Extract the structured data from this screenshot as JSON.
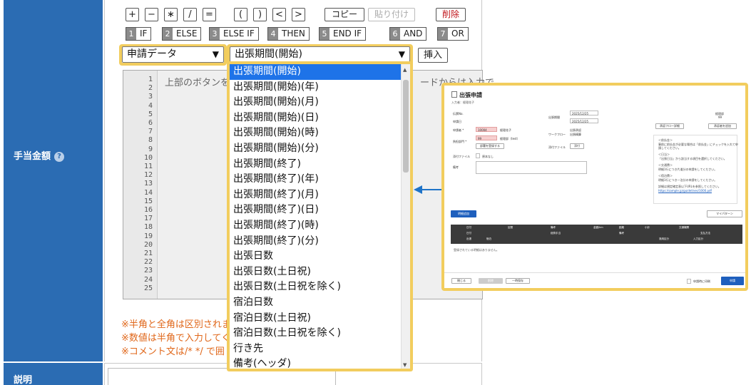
{
  "labels": {
    "amount": "手当金額",
    "amount_help": "?",
    "description": "説明"
  },
  "operators": [
    "+",
    "−",
    "∗",
    "/",
    "=",
    "(",
    ")",
    "<",
    ">"
  ],
  "actions": {
    "copy": "コピー",
    "paste": "貼り付け",
    "delete": "削除",
    "insert": "挿入"
  },
  "keywords": [
    {
      "num": "1",
      "label": "IF"
    },
    {
      "num": "2",
      "label": "ELSE"
    },
    {
      "num": "3",
      "label": "ELSE IF"
    },
    {
      "num": "4",
      "label": "THEN"
    },
    {
      "num": "5",
      "label": "END IF"
    },
    {
      "num": "6",
      "label": "AND"
    },
    {
      "num": "7",
      "label": "OR"
    }
  ],
  "source_select": {
    "value": "申請データ"
  },
  "field_select": {
    "value": "出張期間(開始)"
  },
  "code": {
    "line_numbers": [
      "1",
      "2",
      "3",
      "4",
      "5",
      "6",
      "7",
      "8",
      "9",
      "10",
      "11",
      "12",
      "13",
      "14",
      "15",
      "16",
      "17",
      "18",
      "19",
      "20",
      "21",
      "22",
      "23",
      "24",
      "25"
    ],
    "placeholder_left": "上部のボタンを",
    "placeholder_right": "ードからは入力で"
  },
  "notes": [
    "※半角と全角は区別されま",
    "※数値は半角で入力してく",
    "※コメント文は/* */ で囲"
  ],
  "dropdown_options": [
    "出張期間(開始)",
    "出張期間(開始)(年)",
    "出張期間(開始)(月)",
    "出張期間(開始)(日)",
    "出張期間(開始)(時)",
    "出張期間(開始)(分)",
    "出張期間(終了)",
    "出張期間(終了)(年)",
    "出張期間(終了)(月)",
    "出張期間(終了)(日)",
    "出張期間(終了)(時)",
    "出張期間(終了)(分)",
    "出張日数",
    "出張日数(土日祝)",
    "出張日数(土日祝を除く)",
    "宿泊日数",
    "宿泊日数(土日祝)",
    "宿泊日数(土日祝を除く)",
    "行き先",
    "備考(ヘッダ)"
  ],
  "dropdown_selected_index": 0,
  "preview": {
    "title": "出張申請",
    "applicant_line": "入力者：経理花子",
    "labels": [
      "伝票No.",
      "申請日",
      "申請者 *",
      "負担部門 *",
      "添付ファイル",
      "備考"
    ],
    "applicant_code": "10004",
    "applicant_name": "経理花子",
    "dept_code": "99",
    "dept_name": "経理部（test）",
    "dept_button": "部署を登録する",
    "no_paper_label": "原本なし",
    "period_label": "出張期間",
    "date_start": "2025/12/25",
    "date_end": "2025/12/25",
    "workflow_label": "ワークフロー",
    "workflow_values": [
      "出張承認",
      "出張精算"
    ],
    "attach_button": "添付",
    "flow_buttons": [
      "承認フロー詳細",
      "承認者を追加"
    ],
    "dept_right": "経理部",
    "dept_right_code": "99",
    "note_lines": [
      "＜前払金＞",
      "事前に前払金が必要な場合は「前払金」にチェックを入れて申",
      "請してください。",
      "＜日当＞",
      "「出張日当」から該当する項目を選択してください。",
      "＜交通費＞",
      "明細1行につき片道分の申請をしてください。",
      "＜宿泊費＞",
      "明細1行につき一泊分の申請をしてください。",
      "詳細は規定確定表以下URLを参照してください。",
      "https://sample.jp/guidelines/1000.pdf"
    ],
    "add_detail_button": "明細追加",
    "my_pattern_button": "マイパターン",
    "table_headers_row1": [
      "日付",
      "区間",
      "備考",
      "金額/km",
      "距離",
      "小計",
      "交通機関"
    ],
    "table_headers_row2": [
      "日付",
      "",
      "経費手当",
      "備考",
      "",
      "",
      "支払方法"
    ],
    "table_headers_row3": [
      "出張",
      "宿泊",
      "",
      "",
      "適用区分",
      "",
      "入力区分"
    ],
    "empty_text": "登録されている明細はありません。",
    "footer_buttons": [
      "閉じる",
      "削除",
      "一時保存"
    ],
    "print_label": "申請時に印刷",
    "submit_button": "申請"
  },
  "colors": {
    "label_bg": "#2b6cb3",
    "highlight": "#f2cd5e",
    "selected_option": "#1e73e8",
    "note_text": "#e0671a",
    "danger": "#c0151b"
  }
}
